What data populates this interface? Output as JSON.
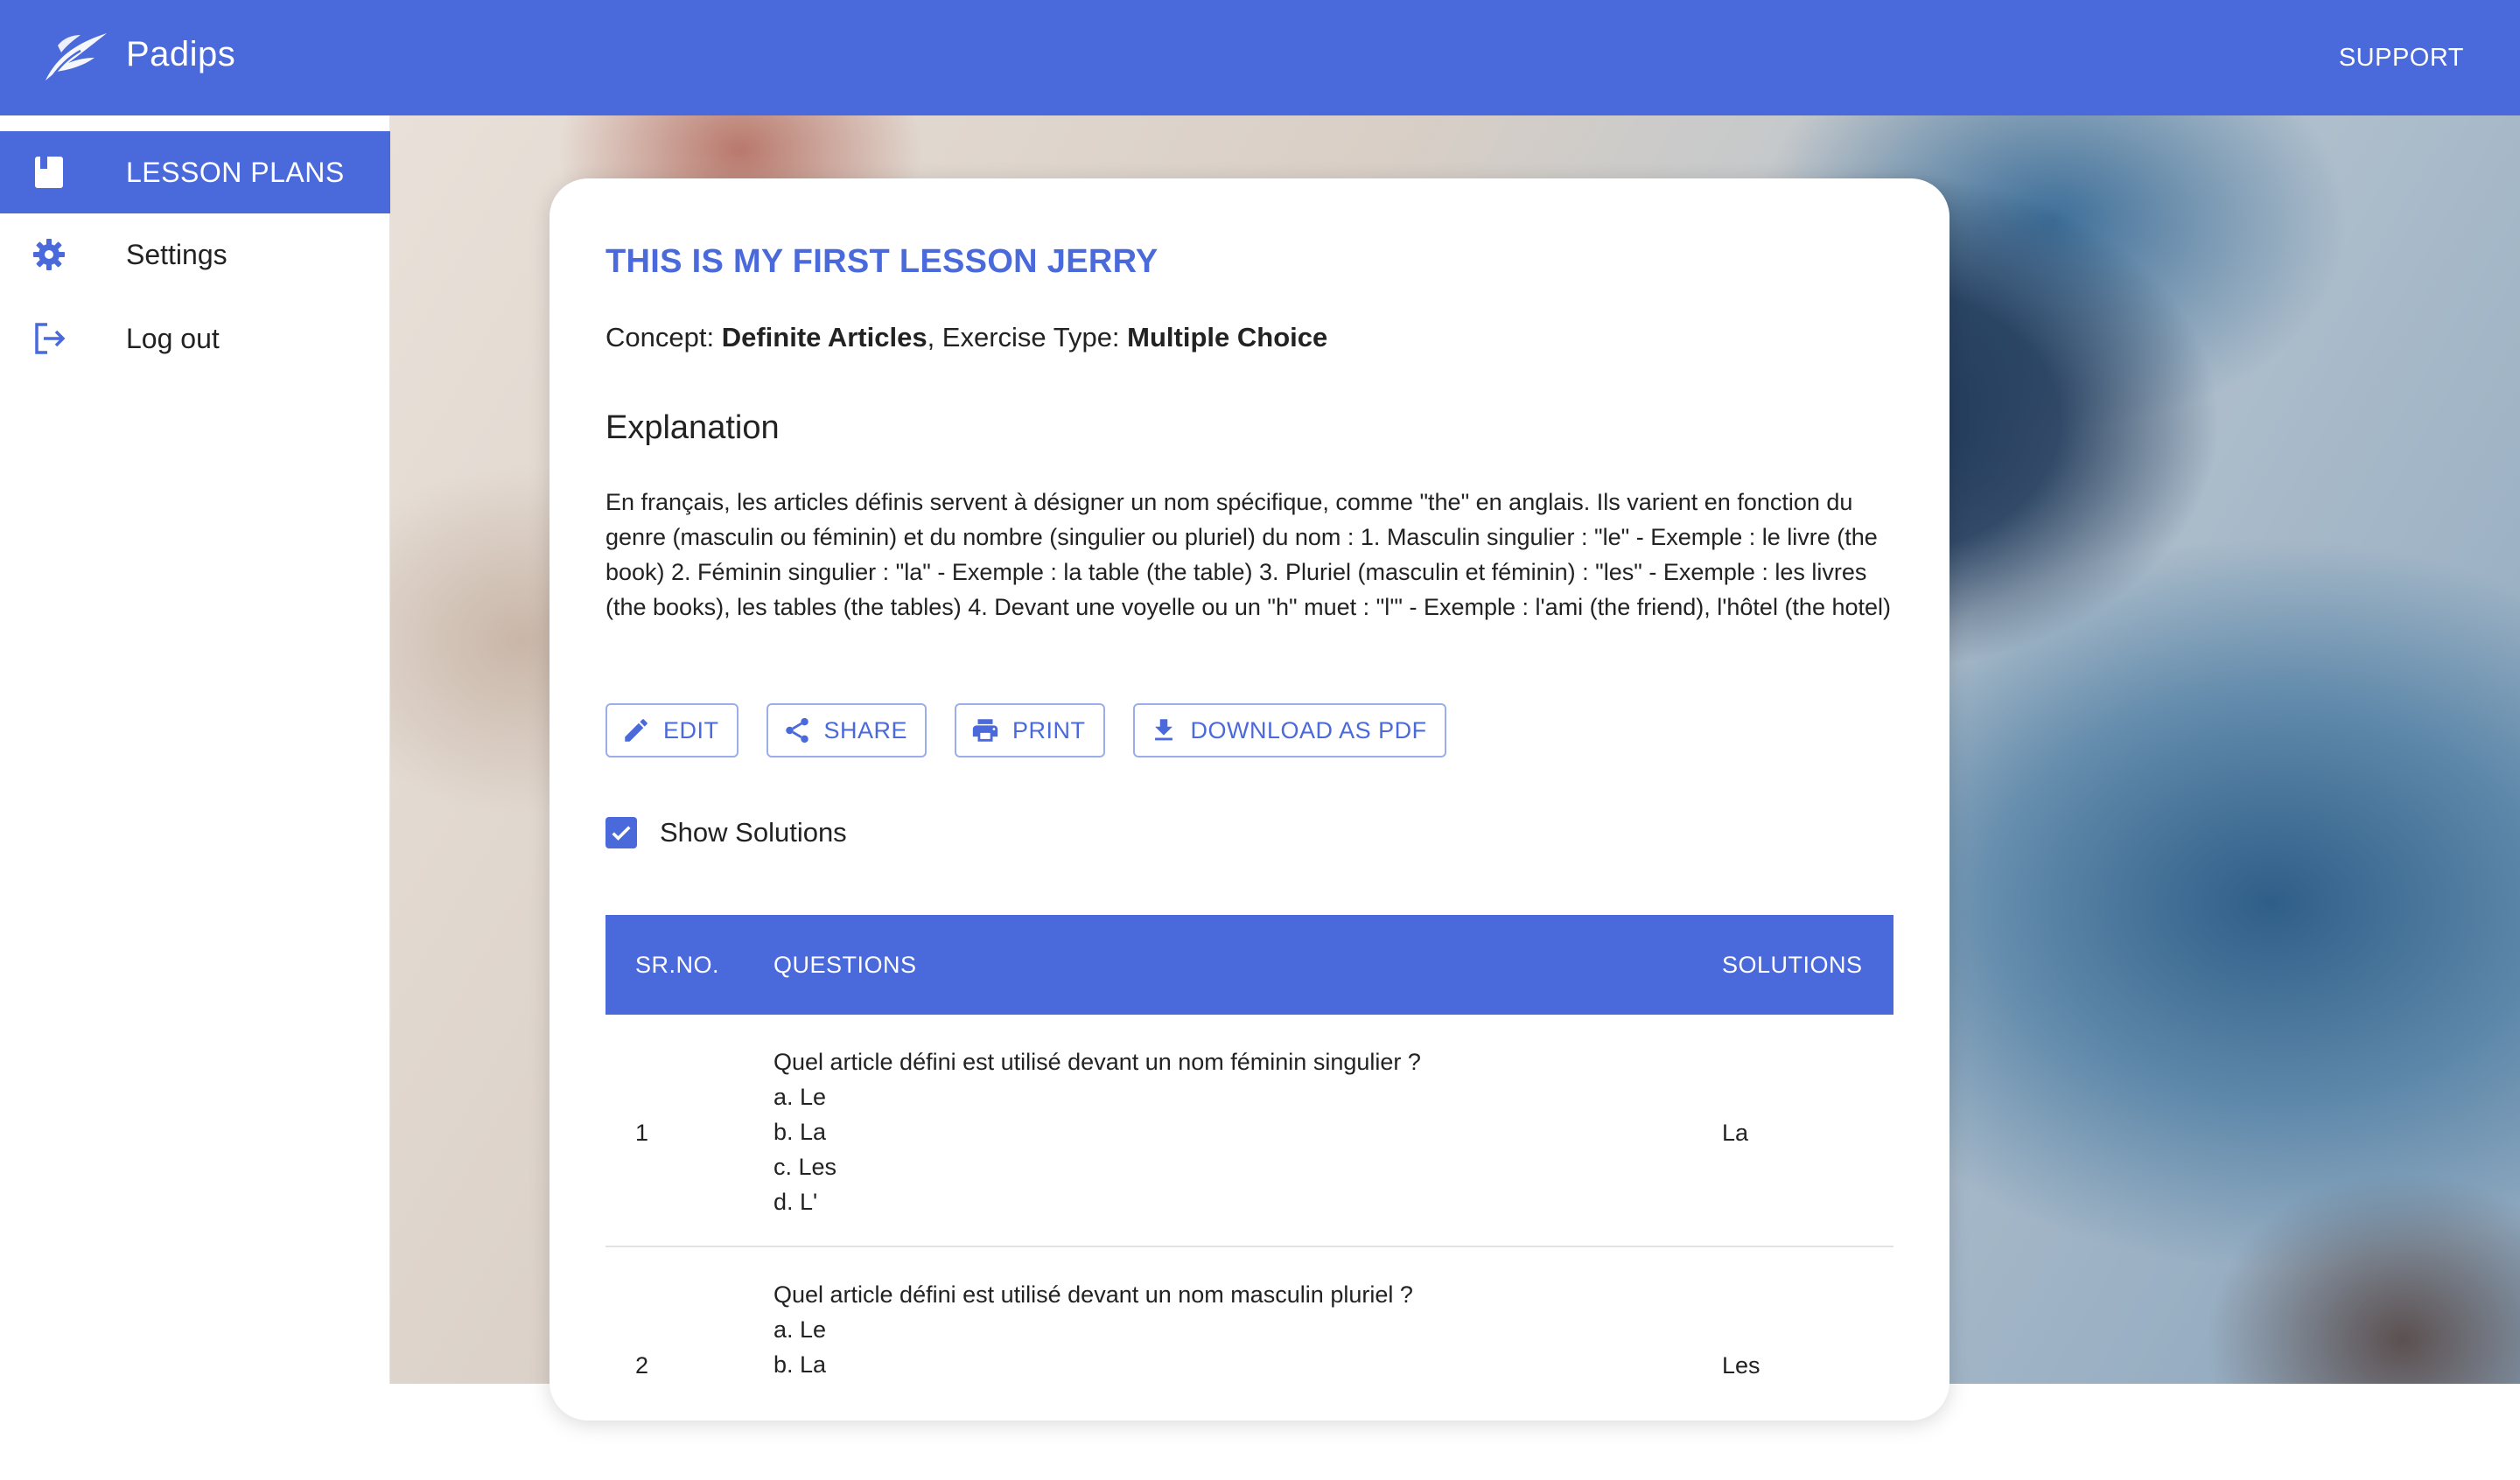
{
  "app": {
    "title": "Padips",
    "support_label": "SUPPORT"
  },
  "sidebar": {
    "items": [
      {
        "label": "LESSON PLANS",
        "icon": "book-icon",
        "active": true
      },
      {
        "label": "Settings",
        "icon": "gear-icon",
        "active": false
      },
      {
        "label": "Log out",
        "icon": "logout-icon",
        "active": false
      }
    ]
  },
  "lesson": {
    "title": "THIS IS MY FIRST LESSON JERRY",
    "concept_label": "Concept: ",
    "concept_value": "Definite Articles",
    "exercise_label": ", Exercise Type: ",
    "exercise_value": "Multiple Choice",
    "explanation_heading": "Explanation",
    "explanation": "En français, les articles définis servent à désigner un nom spécifique, comme \"the\" en anglais. Ils varient en fonction du genre (masculin ou féminin) et du nombre (singulier ou pluriel) du nom : 1. Masculin singulier : \"le\" - Exemple : le livre (the book) 2. Féminin singulier : \"la\" - Exemple : la table (the table) 3. Pluriel (masculin et féminin) : \"les\" - Exemple : les livres (the books), les tables (the tables) 4. Devant une voyelle ou un \"h\" muet : \"l'\" - Exemple : l'ami (the friend), l'hôtel (the hotel)"
  },
  "actions": {
    "edit": "EDIT",
    "share": "SHARE",
    "print": "PRINT",
    "download": "DOWNLOAD AS PDF"
  },
  "show_solutions": {
    "label": "Show Solutions",
    "checked": true
  },
  "table": {
    "headers": {
      "num": "SR.NO.",
      "questions": "QUESTIONS",
      "solutions": "SOLUTIONS"
    },
    "rows": [
      {
        "num": "1",
        "question": "Quel article défini est utilisé devant un nom féminin singulier ?",
        "options": [
          "a. Le",
          "b. La",
          "c. Les",
          "d. L'"
        ],
        "solution": "La"
      },
      {
        "num": "2",
        "question": "Quel article défini est utilisé devant un nom masculin pluriel ?",
        "options": [
          "a. Le",
          "b. La"
        ],
        "solution": "Les"
      }
    ]
  },
  "colors": {
    "primary": "#4a69db",
    "text": "#222222"
  }
}
